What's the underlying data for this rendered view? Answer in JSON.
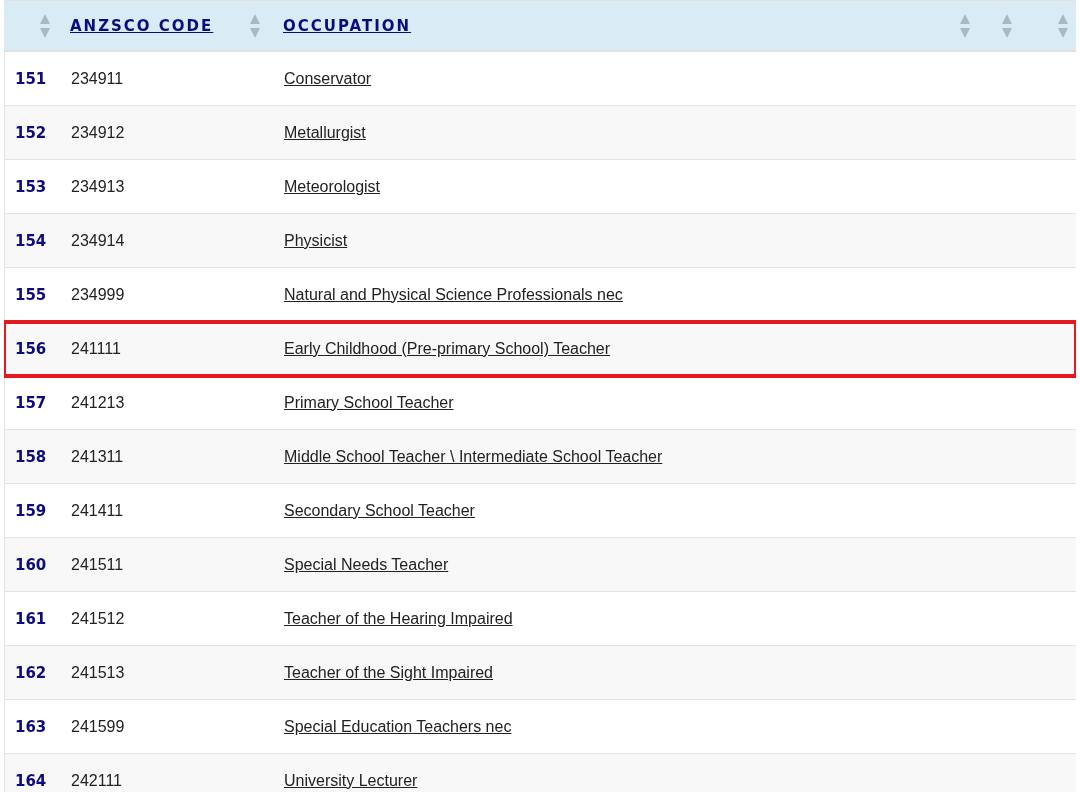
{
  "table": {
    "columns": [
      {
        "sortable": true
      },
      {
        "label": "ANZSCO CODE",
        "sortable": true
      },
      {
        "label": "OCCUPATION",
        "sortable": true
      },
      {
        "sortable": true
      },
      {
        "sortable": true
      }
    ],
    "rows": [
      {
        "number": "151",
        "code": "234911",
        "occupation": "Conservator",
        "highlighted": false
      },
      {
        "number": "152",
        "code": "234912",
        "occupation": "Metallurgist",
        "highlighted": false
      },
      {
        "number": "153",
        "code": "234913",
        "occupation": "Meteorologist",
        "highlighted": false
      },
      {
        "number": "154",
        "code": "234914",
        "occupation": "Physicist",
        "highlighted": false
      },
      {
        "number": "155",
        "code": "234999",
        "occupation": "Natural and Physical Science Professionals nec",
        "highlighted": false
      },
      {
        "number": "156",
        "code": "241111",
        "occupation": "Early Childhood (Pre-primary School) Teacher",
        "highlighted": true
      },
      {
        "number": "157",
        "code": "241213",
        "occupation": "Primary School Teacher",
        "highlighted": false
      },
      {
        "number": "158",
        "code": "241311",
        "occupation": "Middle School Teacher \\ Intermediate School Teacher",
        "highlighted": false
      },
      {
        "number": "159",
        "code": "241411",
        "occupation": "Secondary School Teacher",
        "highlighted": false
      },
      {
        "number": "160",
        "code": "241511",
        "occupation": "Special Needs Teacher",
        "highlighted": false
      },
      {
        "number": "161",
        "code": "241512",
        "occupation": "Teacher of the Hearing Impaired",
        "highlighted": false
      },
      {
        "number": "162",
        "code": "241513",
        "occupation": "Teacher of the Sight Impaired",
        "highlighted": false
      },
      {
        "number": "163",
        "code": "241599",
        "occupation": "Special Education Teachers nec",
        "highlighted": false
      },
      {
        "number": "164",
        "code": "242111",
        "occupation": "University Lecturer",
        "highlighted": false
      }
    ]
  }
}
